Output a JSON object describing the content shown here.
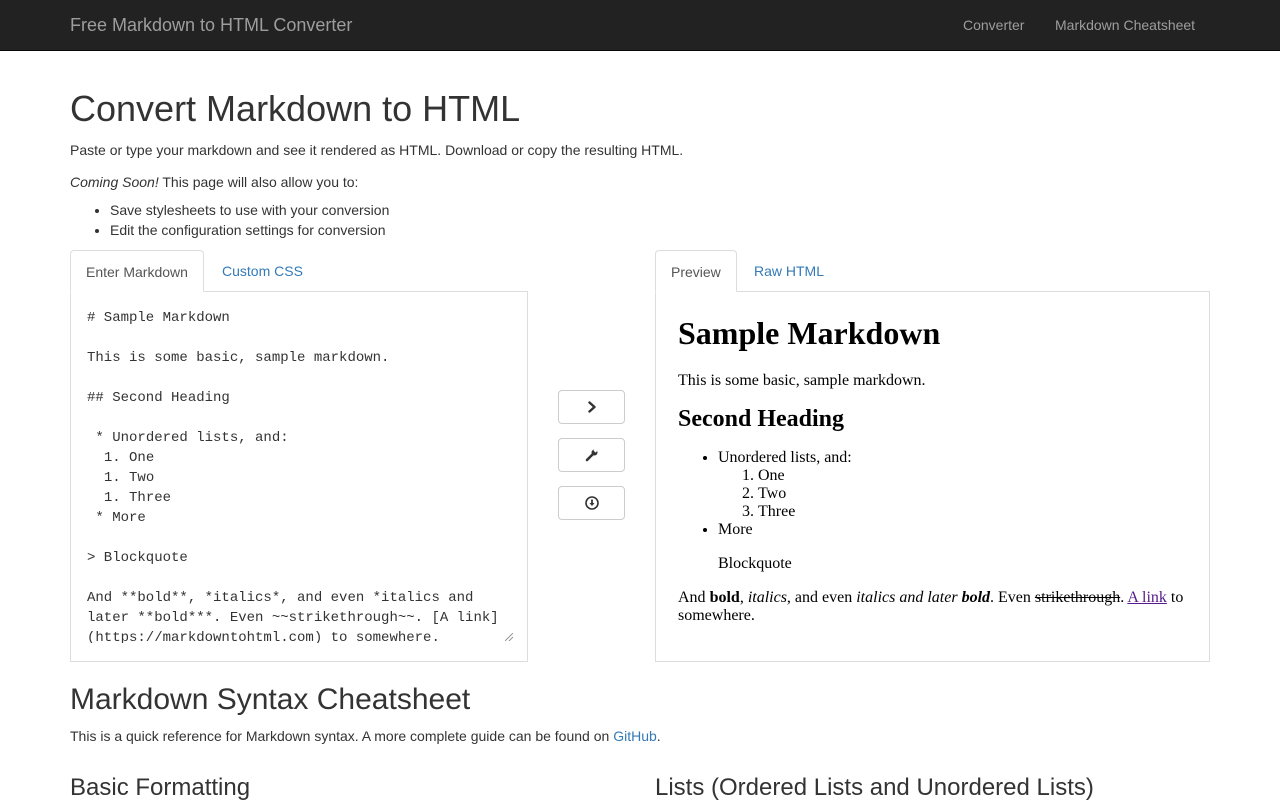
{
  "nav": {
    "brand": "Free Markdown to HTML Converter",
    "links": [
      "Converter",
      "Markdown Cheatsheet"
    ]
  },
  "hero": {
    "title": "Convert Markdown to HTML",
    "intro": "Paste or type your markdown and see it rendered as HTML. Download or copy the resulting HTML.",
    "coming_em": "Coming Soon!",
    "coming_rest": " This page will also allow you to:",
    "features": [
      "Save stylesheets to use with your conversion",
      "Edit the configuration settings for conversion"
    ]
  },
  "left_tabs": [
    "Enter Markdown",
    "Custom CSS"
  ],
  "right_tabs": [
    "Preview",
    "Raw HTML"
  ],
  "editor": {
    "text": "# Sample Markdown\n\nThis is some basic, sample markdown.\n\n## Second Heading\n\n * Unordered lists, and:\n  1. One\n  1. Two\n  1. Three\n * More\n\n> Blockquote\n\nAnd **bold**, *italics*, and even *italics and later **bold***. Even ~~strikethrough~~. [A link](https://markdowntohtml.com) to somewhere."
  },
  "buttons": [
    {
      "icon": "chevron-right-icon"
    },
    {
      "icon": "wrench-icon"
    },
    {
      "icon": "download-icon"
    }
  ],
  "preview": {
    "h1": "Sample Markdown",
    "p1": "This is some basic, sample markdown.",
    "h2": "Second Heading",
    "ul": [
      "Unordered lists, and:",
      "More"
    ],
    "ol": [
      "One",
      "Two",
      "Three"
    ],
    "blockquote": "Blockquote",
    "last": {
      "and": "And ",
      "bold": "bold",
      "sep1": ", ",
      "italics": "italics",
      "sep2": ", and even ",
      "italics2": "italics and later ",
      "bold2": "bold",
      "sep3": ". Even ",
      "strike": "strikethrough",
      "sep4": ". ",
      "link": "A link",
      "tail": " to somewhere."
    }
  },
  "cheatsheet": {
    "title": "Markdown Syntax Cheatsheet",
    "desc": "This is a quick reference for Markdown syntax. A more complete guide can be found on ",
    "link": "GitHub",
    "desc_end": ".",
    "sections": [
      "Basic Formatting",
      "Lists (Ordered Lists and Unordered Lists)"
    ]
  }
}
